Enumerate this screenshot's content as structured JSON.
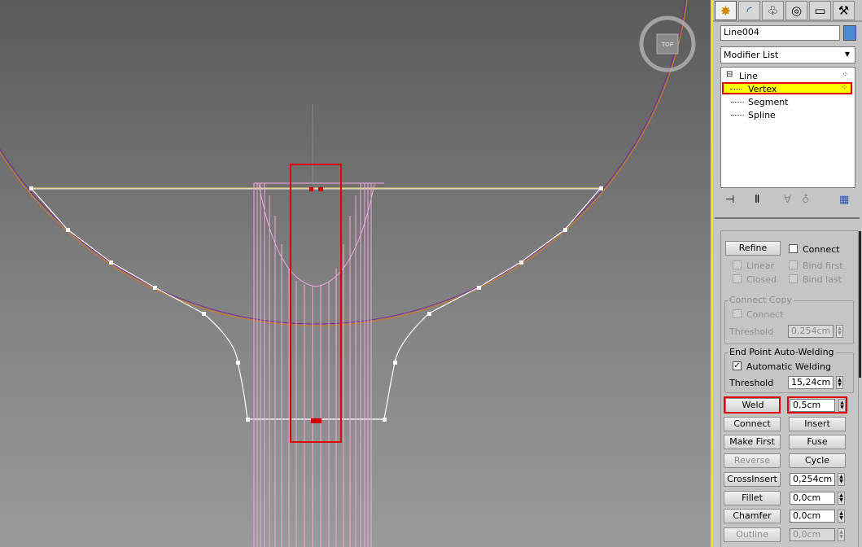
{
  "viewport": {
    "viewcube_label": "TOP",
    "colors": {
      "spline_selected": "#ffffff",
      "circle": "#7a2a9e",
      "circle_outline": "#c97a2a",
      "top_line": "#c8b45a",
      "pink_lines": "#f0a8e0",
      "vertex_marker": "#cc0000",
      "highlight": "#e00000"
    }
  },
  "tabs": [
    {
      "name": "create-tab-icon",
      "glyph": "✸"
    },
    {
      "name": "modify-tab-icon",
      "glyph": "◜"
    },
    {
      "name": "hierarchy-tab-icon",
      "glyph": "♧"
    },
    {
      "name": "motion-tab-icon",
      "glyph": "◎"
    },
    {
      "name": "display-tab-icon",
      "glyph": "▭"
    },
    {
      "name": "utilities-tab-icon",
      "glyph": "⚒"
    }
  ],
  "object_name": "Line004",
  "object_color": "#4a8ad8",
  "modifier_list": "Modifier List",
  "stack": {
    "root": "Line",
    "items": [
      "Vertex",
      "Segment",
      "Spline"
    ],
    "selected": "Vertex",
    "root_expander": "⊟"
  },
  "stack_toolbar": [
    "pin-stack-icon",
    "show-end-result-icon",
    "make-unique-icon",
    "remove-modifier-icon",
    "configure-modifier-sets-icon"
  ],
  "geometry": {
    "refine_label": "Refine",
    "connect_label": "Connect",
    "linear_label": "Linear",
    "closed_label": "Closed",
    "bind_first_label": "Bind first",
    "bind_last_label": "Bind last",
    "connect_copy_title": "Connect Copy",
    "connect_copy_connect_label": "Connect",
    "connect_copy_threshold_label": "Threshold",
    "connect_copy_threshold_value": "0,254cm",
    "autoweld_title": "End Point Auto-Welding",
    "autoweld_label": "Automatic Welding",
    "autoweld_checked": "✓",
    "autoweld_threshold_label": "Threshold",
    "autoweld_threshold_value": "15,24cm",
    "weld_label": "Weld",
    "weld_value": "0,5cm",
    "connect_btn": "Connect",
    "insert_btn": "Insert",
    "make_first_btn": "Make First",
    "fuse_btn": "Fuse",
    "reverse_btn": "Reverse",
    "cycle_btn": "Cycle",
    "crossinsert_btn": "CrossInsert",
    "crossinsert_value": "0,254cm",
    "fillet_btn": "Fillet",
    "fillet_value": "0,0cm",
    "chamfer_btn": "Chamfer",
    "chamfer_value": "0,0cm",
    "outline_btn": "Outline",
    "outline_value": "0,0cm"
  }
}
